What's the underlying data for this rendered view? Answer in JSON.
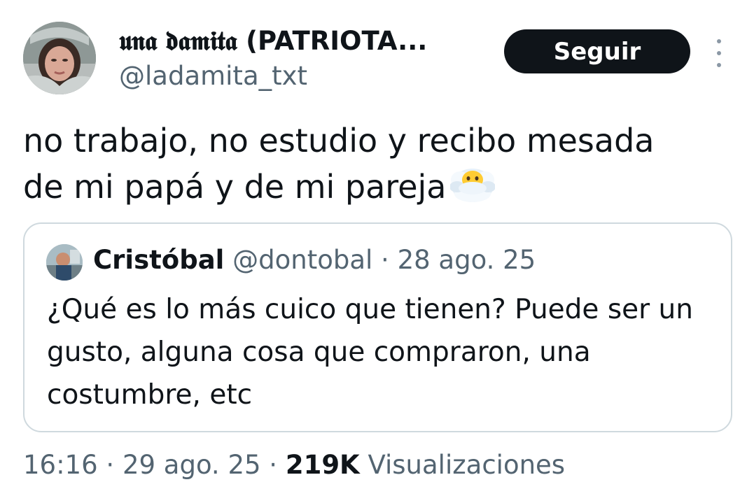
{
  "author": {
    "display_name_styled": "𝖚𝖓𝖆 𝖉𝖆𝖒𝖎𝖙𝖆",
    "display_name_rest": " (PATRIOTA...",
    "handle": "@ladamita_txt",
    "avatar_icon": "user-photo"
  },
  "actions": {
    "follow_label": "Seguir",
    "more_icon": "vertical-ellipsis-icon"
  },
  "tweet": {
    "text_line1": "no trabajo, no estudio y recibo mesada",
    "text_line2": "de mi papá y de mi pareja",
    "emoji": "face-in-clouds-emoji"
  },
  "quoted": {
    "name": "Cristóbal",
    "handle": "@dontobal",
    "separator": " · ",
    "date": "28 ago. 25",
    "text": "¿Qué es lo más cuico que tienen? Puede ser un gusto, alguna cosa que compraron, una costumbre, etc"
  },
  "meta": {
    "time": "16:16",
    "separator": " · ",
    "date": "29 ago. 25",
    "views_count": "219K",
    "views_label": "Visualizaciones"
  },
  "colors": {
    "text": "#0f1419",
    "secondary": "#536471",
    "border": "#cfd9de",
    "button_bg": "#0f1419"
  }
}
